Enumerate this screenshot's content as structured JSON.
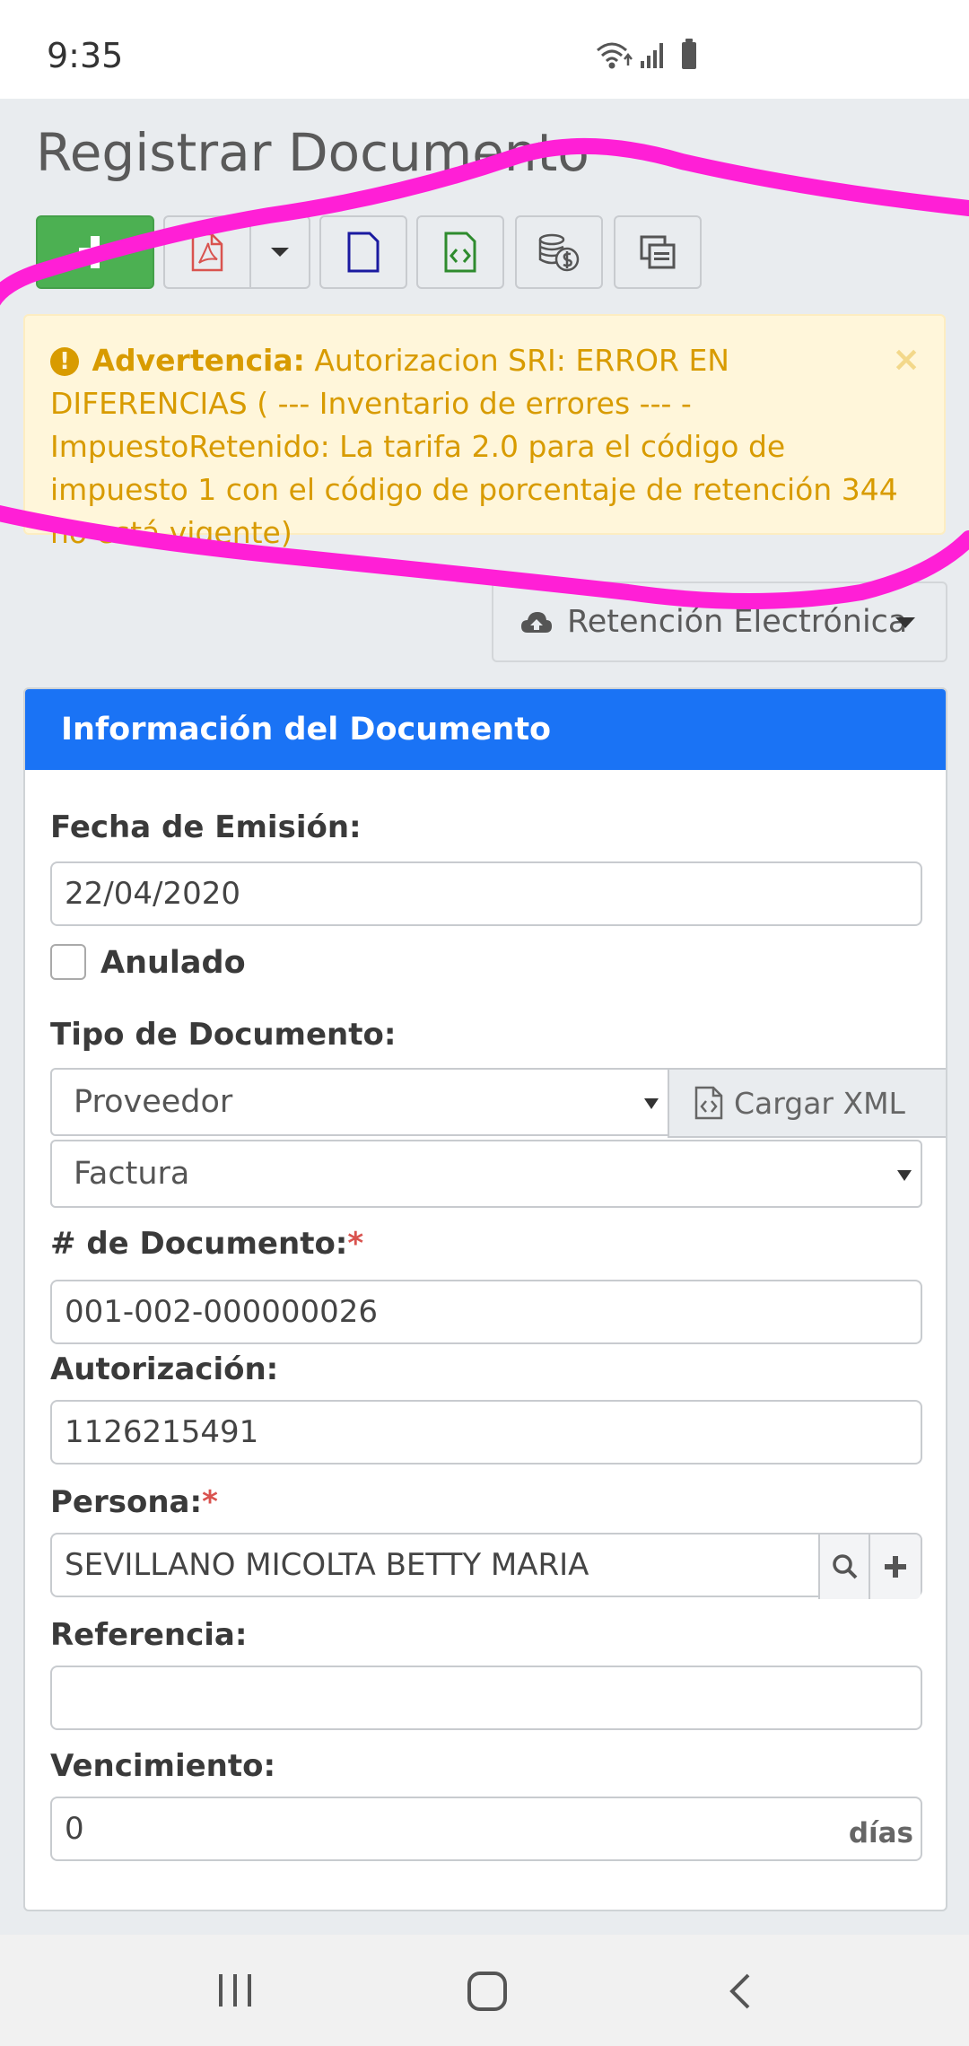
{
  "status_bar": {
    "time": "9:35",
    "icons": [
      "wifi-icon",
      "signal-icon",
      "battery-icon"
    ]
  },
  "page": {
    "title": "Registrar Documento"
  },
  "toolbar": {
    "buttons": [
      {
        "name": "add",
        "icon": "plus-icon",
        "color": "#4cb052"
      },
      {
        "name": "pdf",
        "icon": "pdf-icon"
      },
      {
        "name": "pdf-options",
        "icon": "caret-down-icon"
      },
      {
        "name": "document",
        "icon": "document-icon"
      },
      {
        "name": "xml",
        "icon": "xml-code-icon"
      },
      {
        "name": "payments",
        "icon": "coins-icon"
      },
      {
        "name": "copy",
        "icon": "copy-icon"
      }
    ]
  },
  "alert": {
    "label": "Advertencia:",
    "message": "Autorizacion SRI: ERROR EN DIFERENCIAS ( --- Inventario de errores --- - ImpuestoRetenido: La tarifa 2.0 para el código de impuesto 1 con el código de porcentaje de retención 344 no está vigente)",
    "close": "×",
    "icon": "exclamation-circle-icon",
    "color": "#d89b00"
  },
  "retencion_button": {
    "label": "Retención Electrónica",
    "icon": "cloud-upload-icon"
  },
  "panel": {
    "header": "Información del Documento",
    "header_color": "#1a73f5"
  },
  "form": {
    "fecha_label": "Fecha de Emisión:",
    "fecha_value": "22/04/2020",
    "anulado_label": "Anulado",
    "anulado_checked": false,
    "tipo_label": "Tipo de Documento:",
    "tipo_select": "Proveedor",
    "cargar_xml": "Cargar XML",
    "doc_type_select": "Factura",
    "num_doc_label": "# de Documento:",
    "required_mark": "*",
    "num_doc_value": "001-002-000000026",
    "autorizacion_label": "Autorización:",
    "autorizacion_value": "1126215491",
    "persona_label": "Persona:",
    "persona_value": "SEVILLANO MICOLTA BETTY MARIA",
    "referencia_label": "Referencia:",
    "referencia_value": "",
    "vencimiento_label": "Vencimiento:",
    "vencimiento_value": "0",
    "vencimiento_unit": "días"
  },
  "nav_bar": {
    "buttons": [
      "recent-apps-icon",
      "home-icon",
      "back-icon"
    ]
  }
}
